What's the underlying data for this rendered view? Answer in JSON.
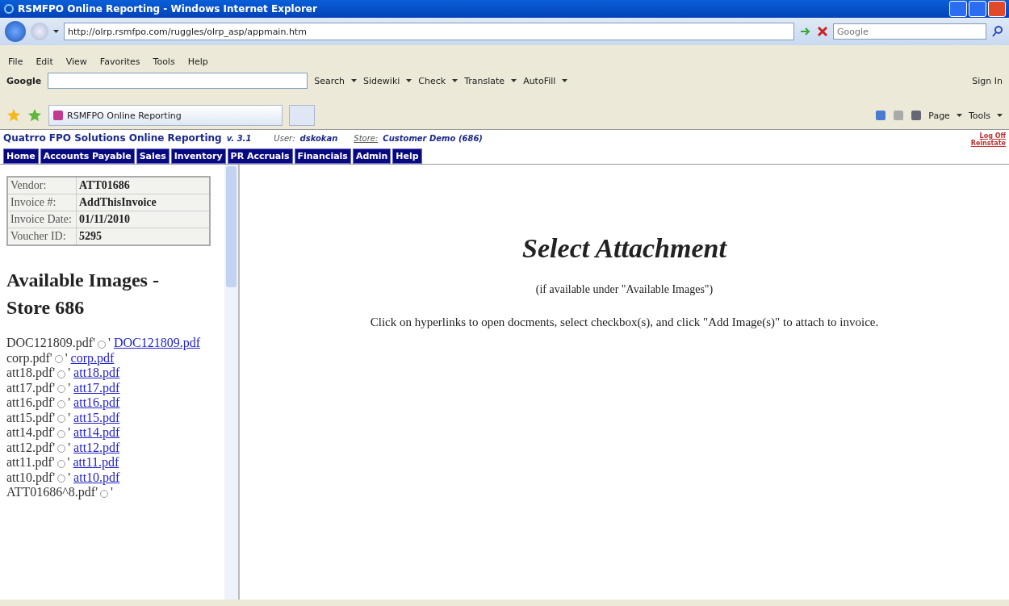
{
  "window": {
    "title": "RSMFPO Online Reporting - Windows Internet Explorer"
  },
  "address_bar": {
    "url": "http://olrp.rsmfpo.com/ruggles/olrp_asp/appmain.htm",
    "search_placeholder": "Google"
  },
  "menu": [
    "File",
    "Edit",
    "View",
    "Favorites",
    "Tools",
    "Help"
  ],
  "google_toolbar": {
    "logo": "Google",
    "items": [
      "Search",
      "Sidewiki",
      "Check",
      "Translate",
      "AutoFill"
    ],
    "sign_in": "Sign In"
  },
  "favorites_bar": {
    "tab": "RSMFPO Online Reporting",
    "commands": [
      "Page",
      "Tools"
    ]
  },
  "app_header": {
    "title": "Quatrro FPO Solutions Online Reporting",
    "version": "v. 3.1",
    "user_label": "User:",
    "user": "dskokan",
    "store_label": "Store:",
    "store": "Customer Demo (686)",
    "links": [
      "Log Off",
      "Reinstate"
    ]
  },
  "nav": [
    "Home",
    "Accounts Payable",
    "Sales",
    "Inventory",
    "PR Accruals",
    "Financials",
    "Admin",
    "Help"
  ],
  "invoice": [
    {
      "label": "Vendor:",
      "value": "ATT01686"
    },
    {
      "label": "Invoice #:",
      "value": "AddThisInvoice"
    },
    {
      "label": "Invoice Date:",
      "value": "01/11/2010"
    },
    {
      "label": "Voucher ID:",
      "value": "5295"
    }
  ],
  "images_heading": "Available Images - Store 686",
  "files": [
    {
      "label": "DOC121809.pdf'",
      "suffix": "'",
      "link": "DOC121809.pdf",
      "selected": false
    },
    {
      "label": "corp.pdf'",
      "suffix": "'",
      "link": "corp.pdf",
      "selected": false
    },
    {
      "label": "att18.pdf'",
      "suffix": "'",
      "link": "att18.pdf",
      "selected": false
    },
    {
      "label": "att17.pdf'",
      "suffix": "'",
      "link": "att17.pdf",
      "selected": false
    },
    {
      "label": "att16.pdf'",
      "suffix": "'",
      "link": "att16.pdf",
      "selected": false
    },
    {
      "label": "att15.pdf'",
      "suffix": "'",
      "link": "att15.pdf",
      "selected": false
    },
    {
      "label": "att14.pdf'",
      "suffix": "'",
      "link": "att14.pdf",
      "selected": false
    },
    {
      "label": "att12.pdf'",
      "suffix": "'",
      "link": "att12.pdf",
      "selected": false
    },
    {
      "label": "att11.pdf'",
      "suffix": "'",
      "link": "att11.pdf",
      "selected": false
    },
    {
      "label": "att10.pdf'",
      "suffix": "'",
      "link": "att10.pdf",
      "selected": false
    },
    {
      "label": "ATT01686^8.pdf'",
      "suffix": "'",
      "selected": false
    }
  ],
  "main": {
    "title": "Select Attachment",
    "subtitle": "(if available under \"Available Images\")",
    "instructions": "Click on hyperlinks to open docments, select checkbox(s), and click \"Add Image(s)\" to attach to invoice."
  }
}
